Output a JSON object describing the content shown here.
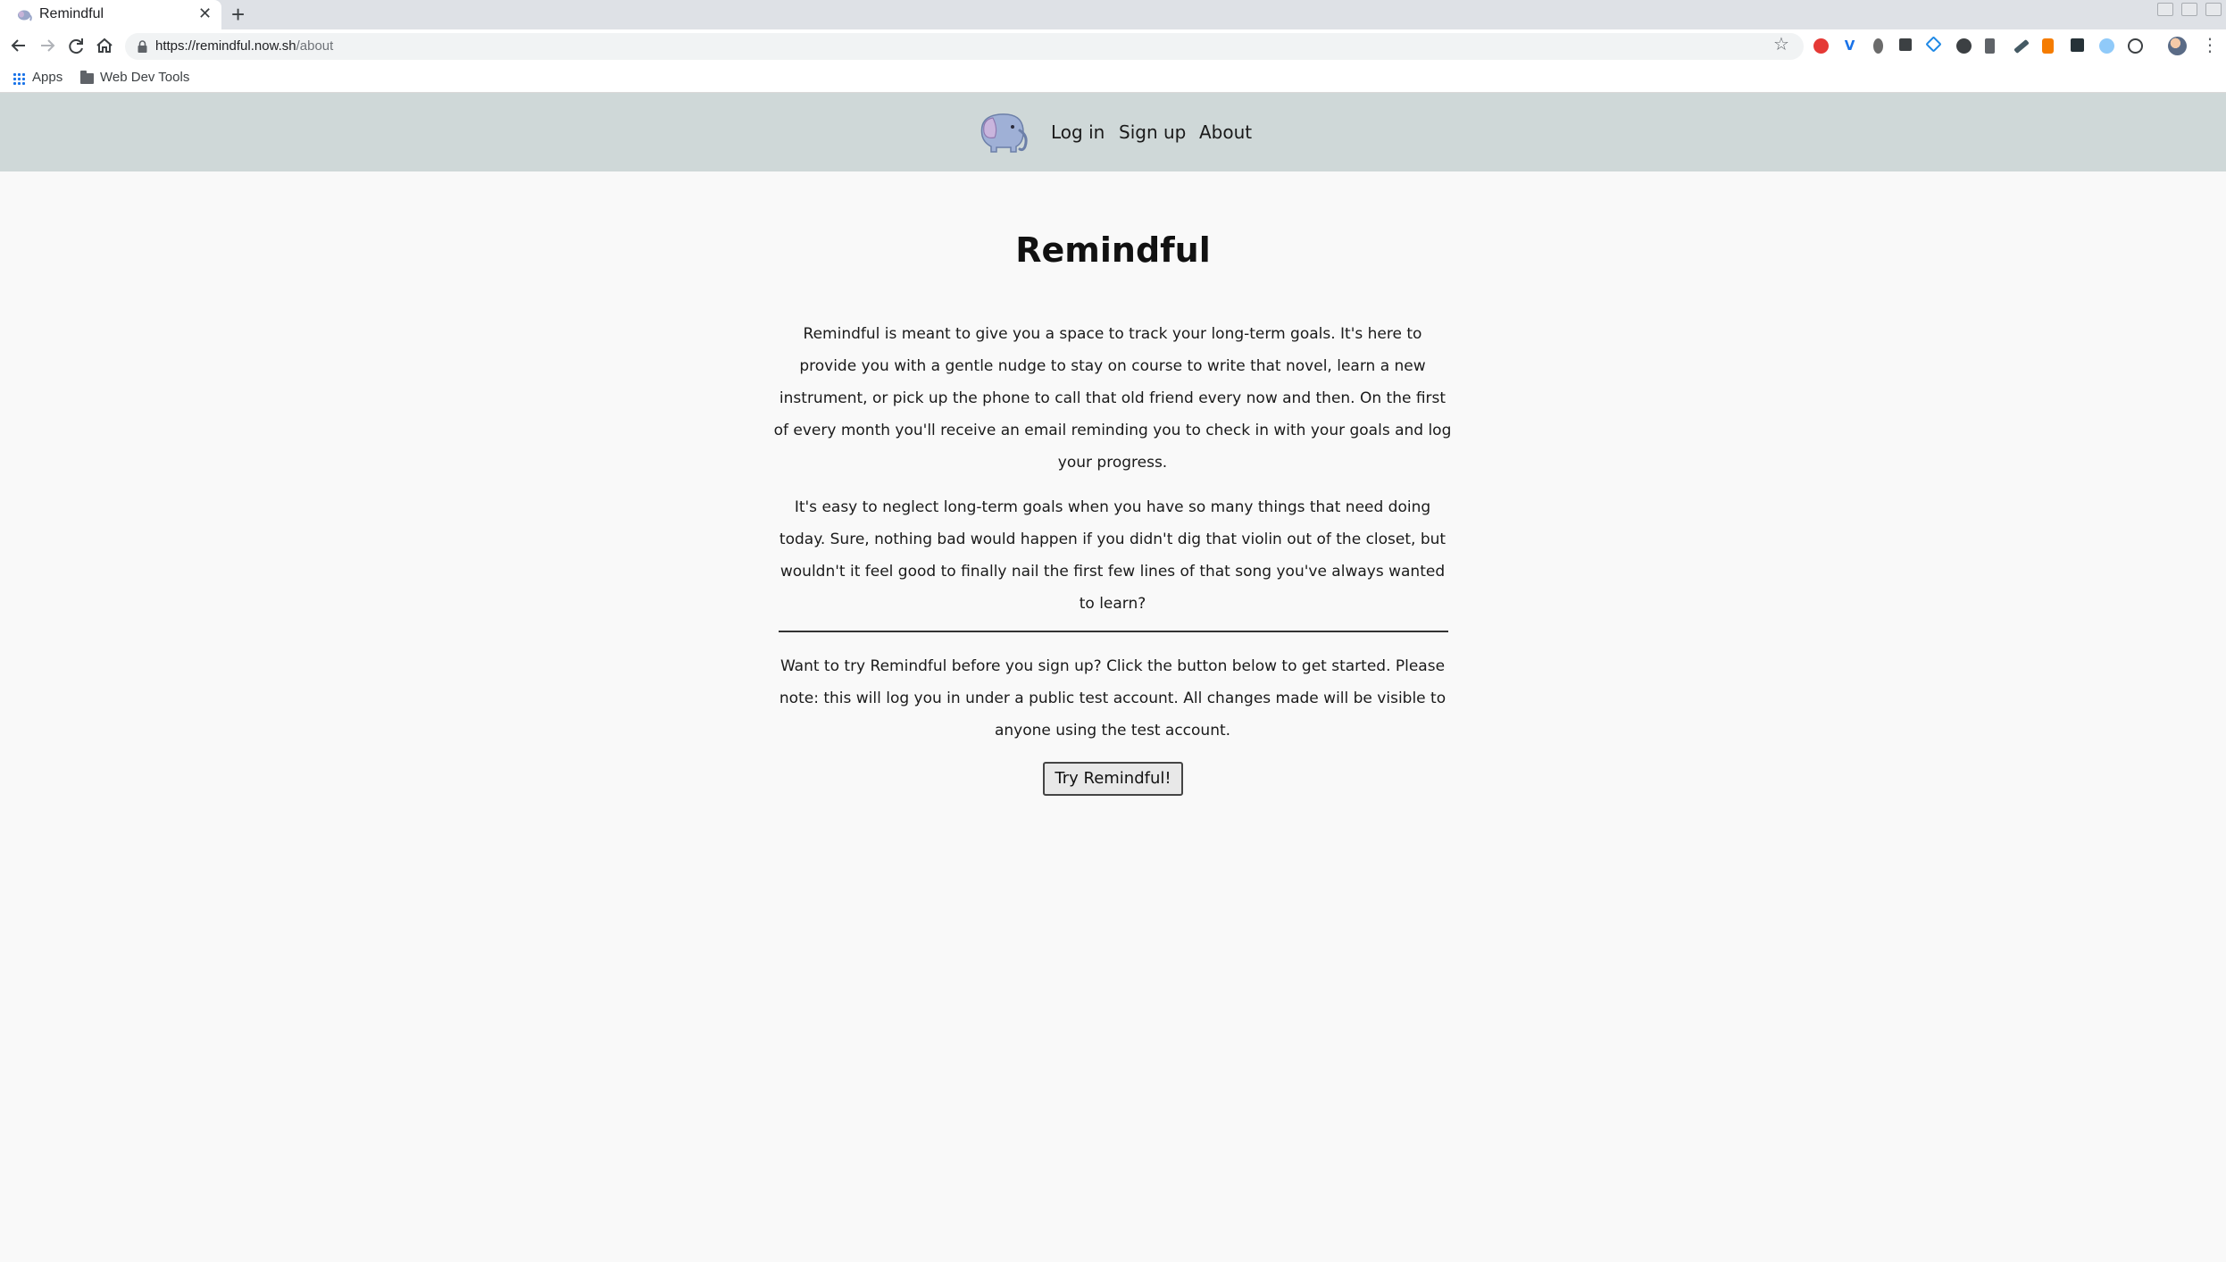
{
  "browser": {
    "tab": {
      "title": "Remindful"
    },
    "address_bar": {
      "url_domain": "https://remindful.now.sh",
      "url_path": "/about"
    },
    "bookmarks": [
      {
        "label": "Apps",
        "icon": "apps-grid-icon"
      },
      {
        "label": "Web Dev Tools",
        "icon": "folder-icon"
      }
    ],
    "extension_icons": [
      "adblock-icon",
      "vimeo-icon",
      "bug-icon",
      "typography-icon",
      "drive-icon",
      "wordpress-icon",
      "bookmark-icon",
      "eyedropper-icon",
      "brave-icon",
      "qr-icon",
      "circle-icon",
      "search-icon"
    ]
  },
  "site": {
    "nav": {
      "logo": "elephant-logo",
      "links": [
        {
          "label": "Log in"
        },
        {
          "label": "Sign up"
        },
        {
          "label": "About"
        }
      ]
    },
    "title": "Remindful",
    "paragraphs": [
      "Remindful is meant to give you a space to track your long-term goals. It's here to provide you with a gentle nudge to stay on course to write that novel, learn a new instrument, or pick up the phone to call that old friend every now and then. On the first of every month you'll receive an email reminding you to check in with your goals and log your progress.",
      "It's easy to neglect long-term goals when you have so many things that need doing today. Sure, nothing bad would happen if you didn't dig that violin out of the closet, but wouldn't it feel good to finally nail the first few lines of that song you've always wanted to learn?"
    ],
    "demo": {
      "text": "Want to try Remindful before you sign up? Click the button below to get started. Please note: this will log you in under a public test account. All changes made will be visible to anyone using the test account.",
      "button_label": "Try Remindful!"
    }
  },
  "colors": {
    "header_bg": "#cfd8d8",
    "page_bg": "#f9f9f9",
    "chrome_bg": "#dee1e6"
  }
}
